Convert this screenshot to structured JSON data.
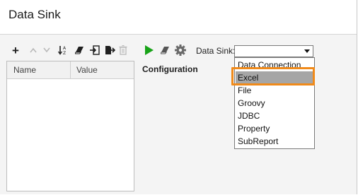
{
  "window": {
    "title": "Data Sink"
  },
  "left_toolbar": {
    "icons": [
      "plus-icon",
      "arrow-up-icon",
      "arrow-down-icon",
      "sort-icon",
      "eraser-icon",
      "import-icon",
      "export-icon",
      "trash-icon"
    ]
  },
  "grid": {
    "columns": [
      "Name",
      "Value"
    ]
  },
  "right_toolbar": {
    "icons": [
      "run-icon",
      "eraser-icon",
      "gear-icon"
    ],
    "data_sink_label": "Data Sink:",
    "selected_value": ""
  },
  "configuration": {
    "label": "Configuration"
  },
  "dropdown": {
    "options": [
      "Data Connection",
      "Excel",
      "File",
      "Groovy",
      "JDBC",
      "Property",
      "SubReport"
    ],
    "highlighted": "Excel"
  },
  "colors": {
    "highlight": "#f08a1a",
    "run": "#18a318",
    "selected_option": "#a6a6a6"
  }
}
